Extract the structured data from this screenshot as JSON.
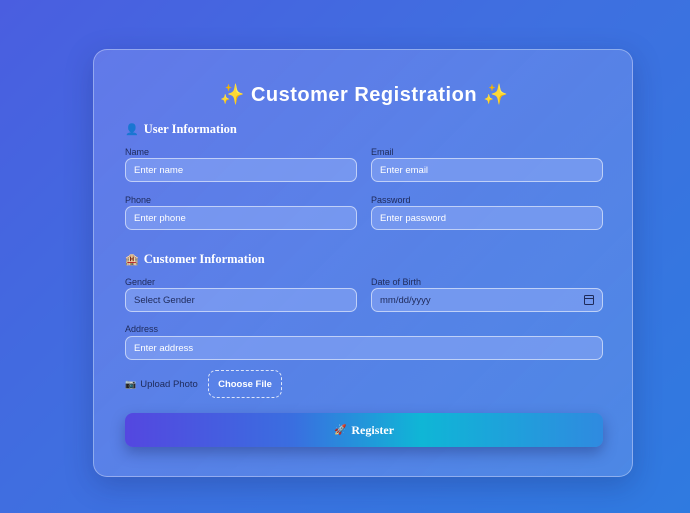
{
  "form": {
    "title": "Customer Registration",
    "title_icon": "sparkles-icon",
    "title_glyph": "✨"
  },
  "user_info": {
    "heading": "User Information",
    "icon": "user-icon",
    "icon_glyph": "👤",
    "name_label": "Name",
    "name_placeholder": "Enter name",
    "email_label": "Email",
    "email_placeholder": "Enter email",
    "phone_label": "Phone",
    "phone_placeholder": "Enter phone",
    "password_label": "Password",
    "password_placeholder": "Enter password"
  },
  "customer_info": {
    "heading": "Customer Information",
    "icon": "building-icon",
    "icon_glyph": "🏨",
    "gender_label": "Gender",
    "gender_value": "Select Gender",
    "dob_label": "Date of Birth",
    "dob_placeholder": "mm/dd/yyyy",
    "address_label": "Address",
    "address_placeholder": "Enter address"
  },
  "upload": {
    "label": "Upload Photo",
    "icon": "camera-icon",
    "icon_glyph": "📷",
    "button_label": "Choose File"
  },
  "submit": {
    "label": "Register",
    "icon": "rocket-icon",
    "icon_glyph": "🚀"
  },
  "colors": {
    "background": "#3f6fe0",
    "button_gradient_start": "#5447e0",
    "button_gradient_mid": "#0fb6d6",
    "label_text": "#1e2a5a"
  }
}
